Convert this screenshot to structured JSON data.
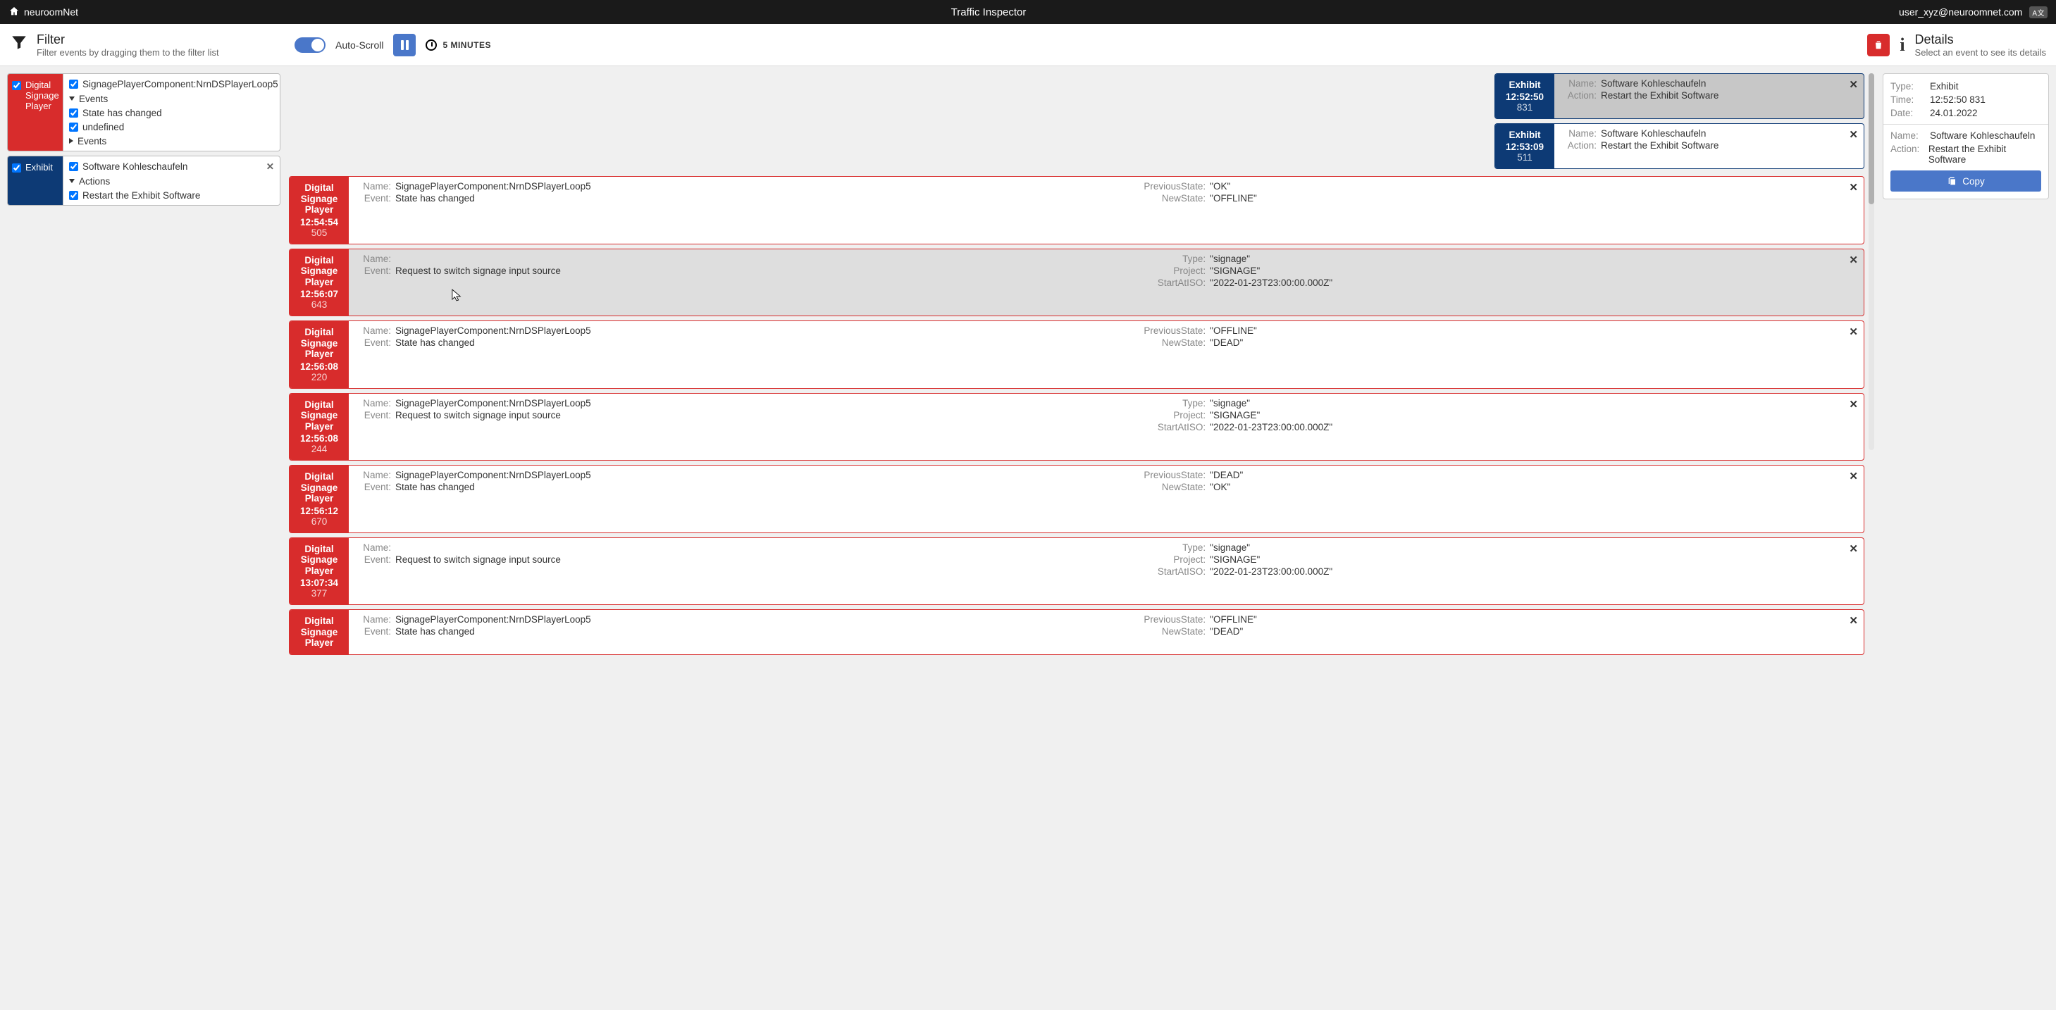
{
  "header": {
    "brand": "neuroomNet",
    "title": "Traffic Inspector",
    "user": "user_xyz@neuroomnet.com",
    "lang": "A文"
  },
  "toolbar": {
    "filter_title": "Filter",
    "filter_sub": "Filter events by dragging them to the filter list",
    "autoscroll": "Auto-Scroll",
    "minutes": "5 MINUTES",
    "details_title": "Details",
    "details_sub": "Select an event to see its details"
  },
  "filters": [
    {
      "color": "red",
      "label": "Digital Signage Player",
      "rows": [
        {
          "type": "check",
          "text": "SignagePlayerComponent:NrnDSPlayerLoop5",
          "x": true
        },
        {
          "type": "caret-down",
          "text": "Events"
        },
        {
          "type": "check",
          "text": "State has changed"
        },
        {
          "type": "check",
          "text": "undefined"
        },
        {
          "type": "caret-right",
          "text": "Events"
        }
      ]
    },
    {
      "color": "blue",
      "label": "Exhibit",
      "rows": [
        {
          "type": "check",
          "text": "Software Kohleschaufeln",
          "x": true
        },
        {
          "type": "caret-down",
          "text": "Actions"
        },
        {
          "type": "check",
          "text": "Restart the Exhibit Software"
        }
      ]
    }
  ],
  "pinned": [
    {
      "selected": true,
      "label": "Exhibit",
      "time": "12:52:50",
      "ms": "831",
      "kv": [
        [
          "Name:",
          "Software Kohleschaufeln"
        ],
        [
          "Action:",
          "Restart the Exhibit Software"
        ]
      ]
    },
    {
      "selected": false,
      "label": "Exhibit",
      "time": "12:53:09",
      "ms": "511",
      "kv": [
        [
          "Name:",
          "Software Kohleschaufeln"
        ],
        [
          "Action:",
          "Restart the Exhibit Software"
        ]
      ]
    }
  ],
  "events": [
    {
      "label": "Digital Signage Player",
      "time": "12:54:54",
      "ms": "505",
      "col1": [
        [
          "Name:",
          "SignagePlayerComponent:NrnDSPlayerLoop5"
        ],
        [
          "Event:",
          "State has changed"
        ]
      ],
      "col2": [
        [
          "PreviousState:",
          "\"OK\""
        ],
        [
          "NewState:",
          "\"OFFLINE\""
        ]
      ]
    },
    {
      "label": "Digital Signage Player",
      "time": "12:56:07",
      "ms": "643",
      "hover": true,
      "col1": [
        [
          "Name:",
          ""
        ],
        [
          "Event:",
          "Request to switch signage input source"
        ]
      ],
      "col2": [
        [
          "Type:",
          "\"signage\""
        ],
        [
          "Project:",
          "\"SIGNAGE\""
        ],
        [
          "StartAtISO:",
          "\"2022-01-23T23:00:00.000Z\""
        ]
      ]
    },
    {
      "label": "Digital Signage Player",
      "time": "12:56:08",
      "ms": "220",
      "col1": [
        [
          "Name:",
          "SignagePlayerComponent:NrnDSPlayerLoop5"
        ],
        [
          "Event:",
          "State has changed"
        ]
      ],
      "col2": [
        [
          "PreviousState:",
          "\"OFFLINE\""
        ],
        [
          "NewState:",
          "\"DEAD\""
        ]
      ]
    },
    {
      "label": "Digital Signage Player",
      "time": "12:56:08",
      "ms": "244",
      "col1": [
        [
          "Name:",
          "SignagePlayerComponent:NrnDSPlayerLoop5"
        ],
        [
          "Event:",
          "Request to switch signage input source"
        ]
      ],
      "col2": [
        [
          "Type:",
          "\"signage\""
        ],
        [
          "Project:",
          "\"SIGNAGE\""
        ],
        [
          "StartAtISO:",
          "\"2022-01-23T23:00:00.000Z\""
        ]
      ]
    },
    {
      "label": "Digital Signage Player",
      "time": "12:56:12",
      "ms": "670",
      "col1": [
        [
          "Name:",
          "SignagePlayerComponent:NrnDSPlayerLoop5"
        ],
        [
          "Event:",
          "State has changed"
        ]
      ],
      "col2": [
        [
          "PreviousState:",
          "\"DEAD\""
        ],
        [
          "NewState:",
          "\"OK\""
        ]
      ]
    },
    {
      "label": "Digital Signage Player",
      "time": "13:07:34",
      "ms": "377",
      "col1": [
        [
          "Name:",
          ""
        ],
        [
          "Event:",
          "Request to switch signage input source"
        ]
      ],
      "col2": [
        [
          "Type:",
          "\"signage\""
        ],
        [
          "Project:",
          "\"SIGNAGE\""
        ],
        [
          "StartAtISO:",
          "\"2022-01-23T23:00:00.000Z\""
        ]
      ]
    },
    {
      "label": "Digital Signage Player",
      "time": "",
      "ms": "",
      "col1": [
        [
          "Name:",
          "SignagePlayerComponent:NrnDSPlayerLoop5"
        ],
        [
          "Event:",
          "State has changed"
        ]
      ],
      "col2": [
        [
          "PreviousState:",
          "\"OFFLINE\""
        ],
        [
          "NewState:",
          "\"DEAD\""
        ]
      ]
    }
  ],
  "details": {
    "rows1": [
      [
        "Type:",
        "Exhibit"
      ],
      [
        "Time:",
        "12:52:50 831"
      ],
      [
        "Date:",
        "24.01.2022"
      ]
    ],
    "rows2": [
      [
        "Name:",
        "Software Kohleschaufeln"
      ],
      [
        "Action:",
        "Restart the Exhibit Software"
      ]
    ],
    "copy": "Copy"
  }
}
